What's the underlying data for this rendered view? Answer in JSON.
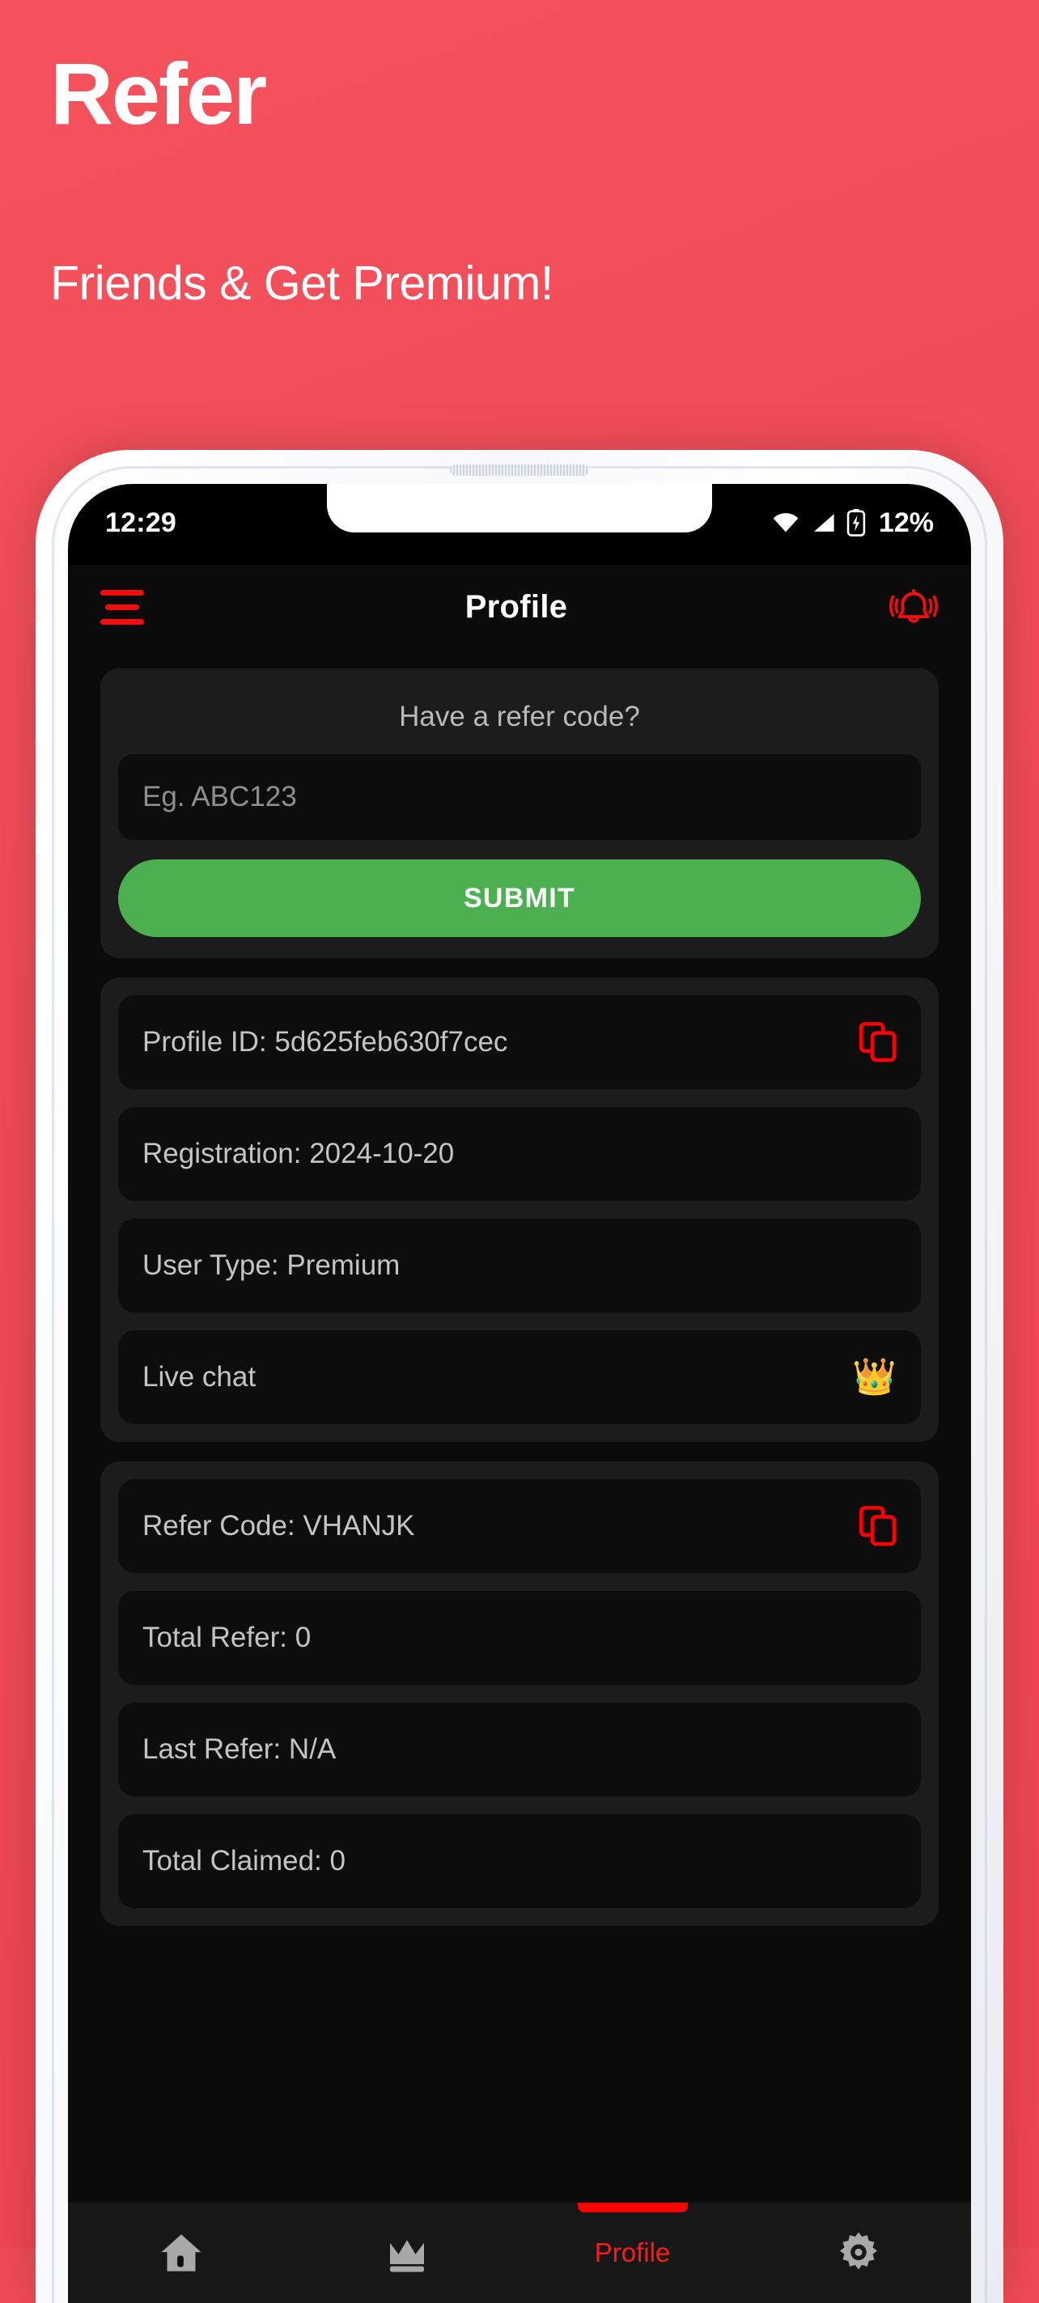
{
  "promo": {
    "title": "Refer",
    "subtitle": "Friends & Get Premium!",
    "background_color": "#ef4a56",
    "text_color": "#ffffff"
  },
  "status_bar": {
    "time": "12:29",
    "battery_percent": "12%",
    "icons": [
      "wifi-icon",
      "cellular-signal-icon",
      "battery-charging-icon"
    ]
  },
  "app_bar": {
    "title": "Profile",
    "menu_icon": "hamburger-menu-icon",
    "notification_icon": "notification-bell-icon",
    "accent_color": "#f40d0d"
  },
  "refer_code_card": {
    "heading": "Have a refer code?",
    "input_placeholder": "Eg. ABC123",
    "input_value": "",
    "submit_label": "SUBMIT",
    "submit_color": "#4caf50"
  },
  "account_card": {
    "rows": [
      {
        "label": "Profile ID: 5d625feb630f7cec",
        "trailing": "copy-icon"
      },
      {
        "label": "Registration: 2024-10-20",
        "trailing": ""
      },
      {
        "label": "User Type: Premium",
        "trailing": ""
      },
      {
        "label": "Live chat",
        "trailing": "crown-emoji",
        "trailing_glyph": "👑"
      }
    ]
  },
  "referral_card": {
    "rows": [
      {
        "label": "Refer Code: VHANJK",
        "trailing": "copy-icon"
      },
      {
        "label": "Total Refer: 0",
        "trailing": ""
      },
      {
        "label": "Last Refer: N/A",
        "trailing": ""
      },
      {
        "label": "Total Claimed: 0",
        "trailing": ""
      }
    ]
  },
  "bottom_nav": {
    "active_color": "#ff1a1a",
    "inactive_color": "#a8a8a8",
    "items": [
      {
        "label": "",
        "icon": "home-icon",
        "active": false
      },
      {
        "label": "",
        "icon": "crown-icon",
        "active": false
      },
      {
        "label": "Profile",
        "icon": "",
        "active": true
      },
      {
        "label": "",
        "icon": "gear-icon",
        "active": false
      }
    ]
  }
}
